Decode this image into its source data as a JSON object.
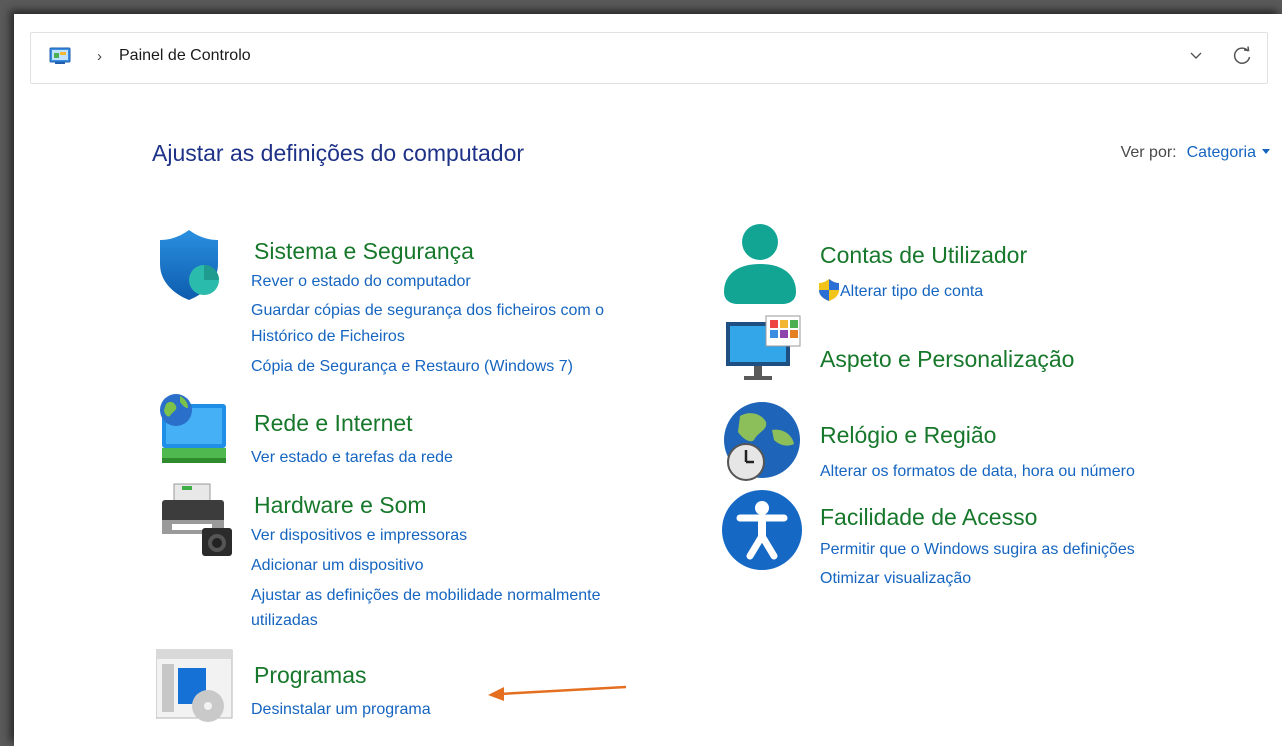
{
  "address": {
    "breadcrumb": "Painel de Controlo"
  },
  "heading": "Ajustar as definições do computador",
  "view_by": {
    "label": "Ver por:",
    "value": "Categoria"
  },
  "categories": {
    "system_security": {
      "title": "Sistema e Segurança",
      "links": [
        "Rever o estado do computador",
        "Guardar cópias de segurança dos ficheiros com o",
        "Histórico de Ficheiros",
        "Cópia de Segurança e Restauro (Windows 7)"
      ]
    },
    "network": {
      "title": "Rede e Internet",
      "links": [
        "Ver estado e tarefas da rede"
      ]
    },
    "hardware": {
      "title": "Hardware e Som",
      "links": [
        "Ver dispositivos e impressoras",
        "Adicionar um dispositivo",
        "Ajustar as definições de mobilidade normalmente",
        "utilizadas"
      ]
    },
    "programs": {
      "title": "Programas",
      "links": [
        "Desinstalar um programa"
      ]
    },
    "user_accounts": {
      "title": "Contas de Utilizador",
      "links": [
        "Alterar tipo de conta"
      ]
    },
    "appearance": {
      "title": "Aspeto e Personalização",
      "links": []
    },
    "clock_region": {
      "title": "Relógio e Região",
      "links": [
        "Alterar os formatos de data, hora ou número"
      ]
    },
    "ease_access": {
      "title": "Facilidade de Acesso",
      "links": [
        "Permitir que o Windows sugira as definições",
        "Otimizar visualização"
      ]
    }
  },
  "colors": {
    "category_title": "#17782b",
    "link": "#1565c0",
    "heading": "#1e3287",
    "annotation_arrow": "#e46f21"
  },
  "icons": [
    "control-panel-icon",
    "chevron-right-icon",
    "chevron-down-icon",
    "refresh-icon",
    "shield-icon",
    "network-icon",
    "printer-icon",
    "programs-icon",
    "user-icon",
    "uac-shield-icon",
    "monitor-icon",
    "globe-clock-icon",
    "accessibility-icon",
    "arrow-annotation-icon"
  ]
}
